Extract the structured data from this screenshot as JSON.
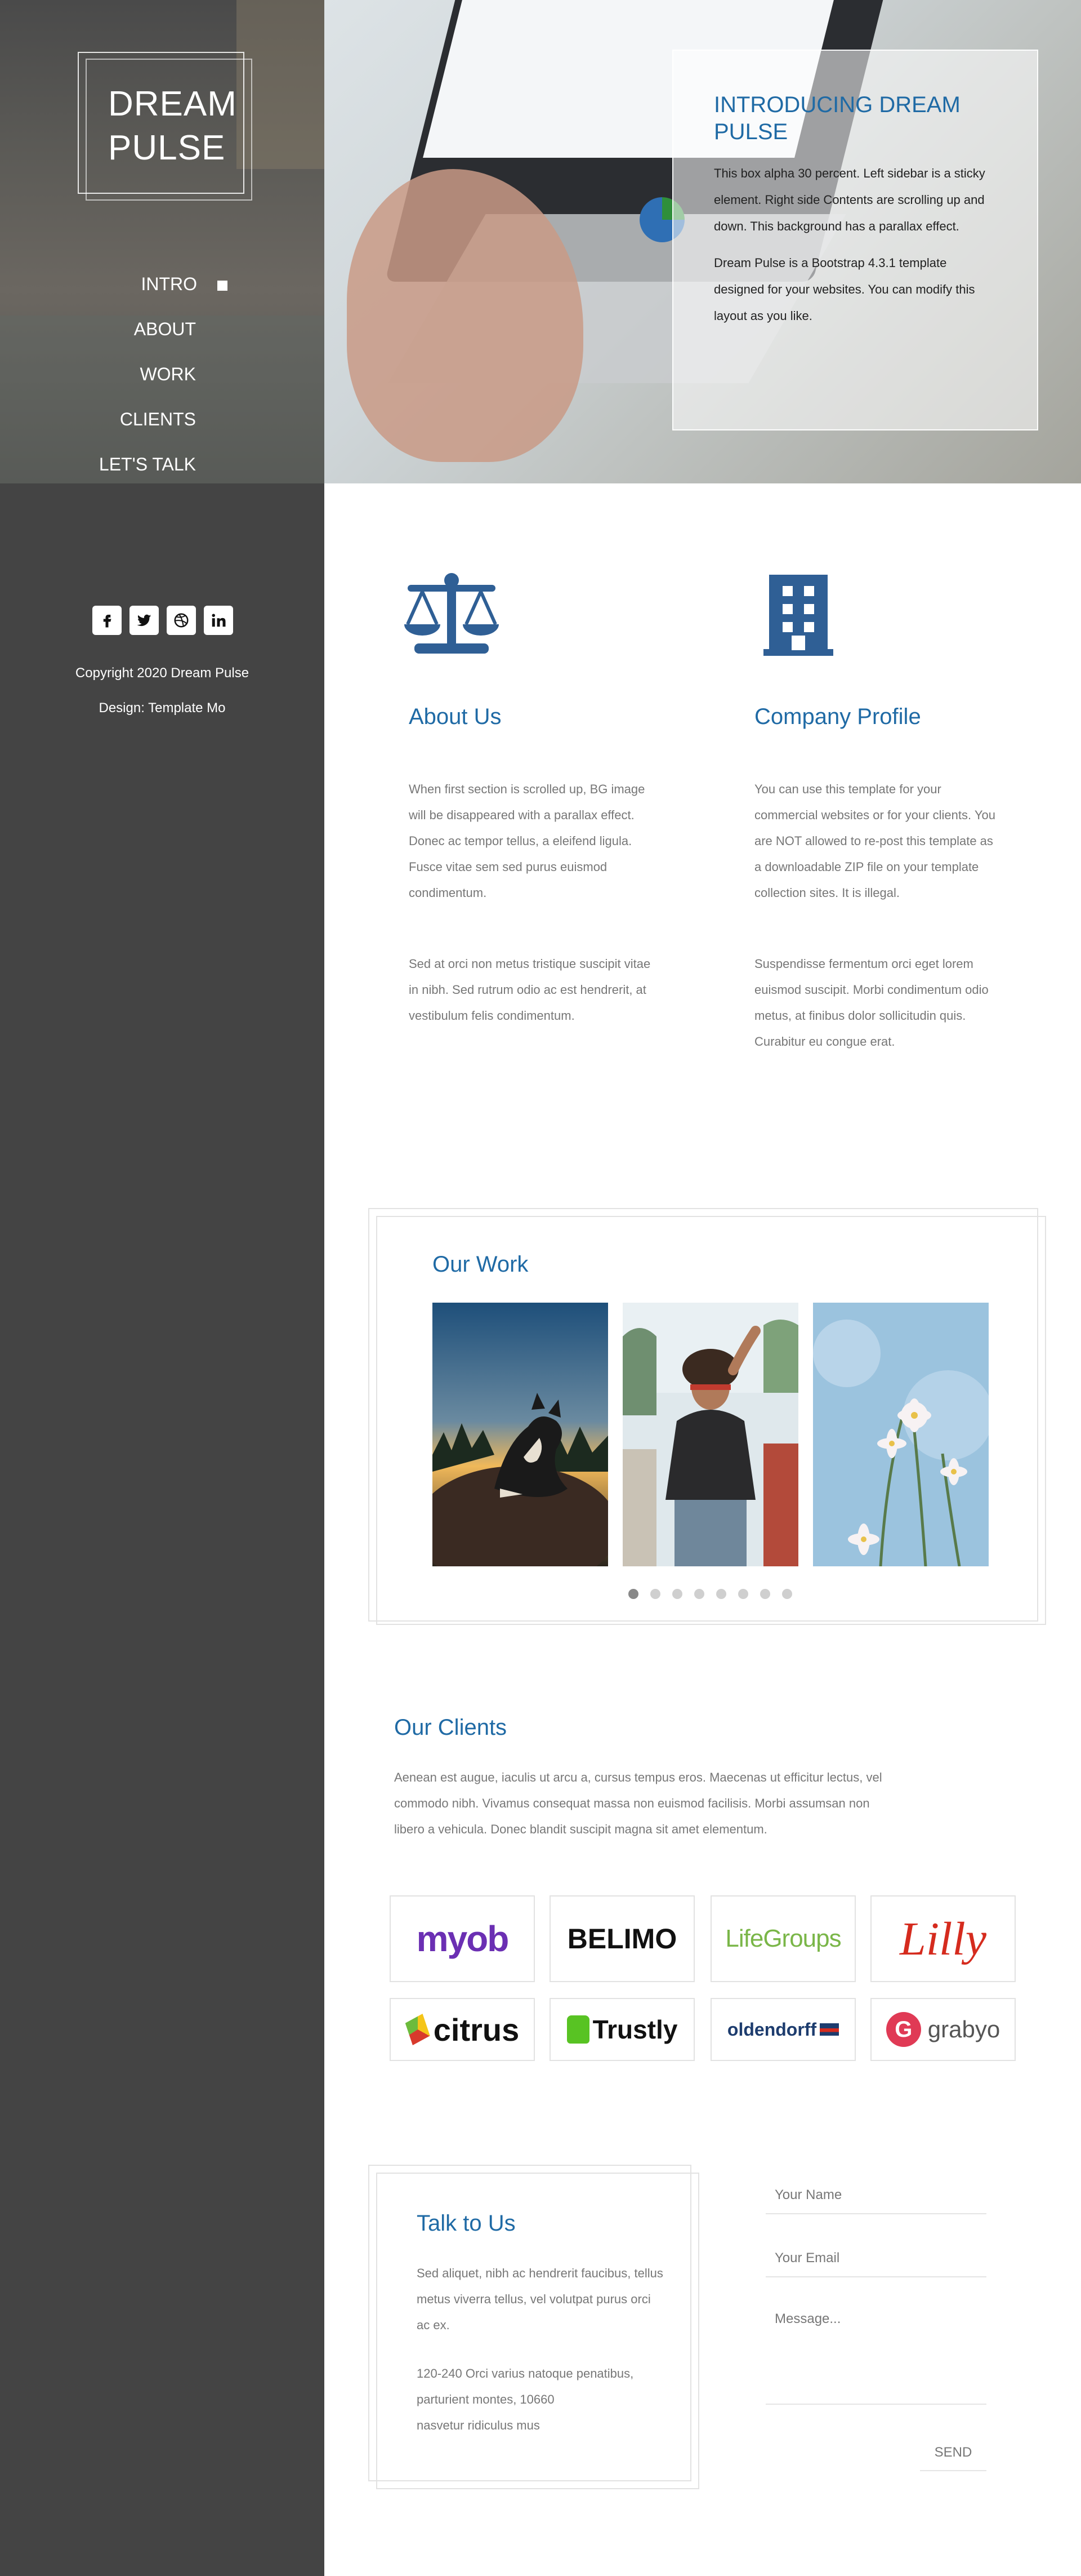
{
  "brand": {
    "line1": "DREAM",
    "line2": "PULSE"
  },
  "nav": {
    "items": [
      {
        "label": "INTRO",
        "active": true
      },
      {
        "label": "ABOUT",
        "active": false
      },
      {
        "label": "WORK",
        "active": false
      },
      {
        "label": "CLIENTS",
        "active": false
      },
      {
        "label": "LET'S TALK",
        "active": false
      }
    ]
  },
  "social": [
    {
      "icon": "facebook-icon"
    },
    {
      "icon": "twitter-icon"
    },
    {
      "icon": "dribbble-icon"
    },
    {
      "icon": "linkedin-icon"
    }
  ],
  "footer": {
    "copyright": "Copyright 2020 Dream Pulse",
    "design": "Design: Template Mo"
  },
  "hero": {
    "title": "INTRODUCING DREAM PULSE",
    "p1": "This box alpha 30 percent. Left sidebar is a sticky element. Right side Contents are scrolling up and down. This background has a parallax effect.",
    "p2": "Dream Pulse is a Bootstrap 4.3.1 template designed for your websites. You can modify this layout as you like."
  },
  "about": {
    "title": "About Us",
    "icon": "scale-icon",
    "p1": "When first section is scrolled up, BG image will be disappeared with a parallax effect. Donec ac tempor tellus, a eleifend ligula. Fusce vitae sem sed purus euismod condimentum.",
    "p2": "Sed at orci non metus tristique suscipit vitae in nibh. Sed rutrum odio ac est hendrerit, at vestibulum felis condimentum."
  },
  "company": {
    "title": "Company Profile",
    "icon": "building-icon",
    "p1": "You can use this template for your commercial websites or for your clients. You are NOT allowed to re-post this template as a downloadable ZIP file on your template collection sites. It is illegal.",
    "p2": "Suspendisse fermentum orci eget lorem euismod suscipit. Morbi condimentum odio metus, at finibus dolor sollicitudin quis. Curabitur eu congue erat."
  },
  "work": {
    "title": "Our Work",
    "images": [
      "dog-photo",
      "woman-photo",
      "flowers-photo"
    ],
    "slide_count": 8,
    "active_slide": 1
  },
  "clients": {
    "title": "Our Clients",
    "p": "Aenean est augue, iaculis ut arcu a, cursus tempus eros. Maecenas ut efficitur lectus, vel commodo nibh. Vivamus consequat massa non euismod facilisis. Morbi assumsan non libero a vehicula. Donec blandit suscipit magna sit amet elementum.",
    "logos": [
      {
        "text": "myob",
        "color": "#6b2fb3"
      },
      {
        "text": "BELIMO",
        "color": "#111111",
        "accent": "#f26522"
      },
      {
        "text": "LifeGroups",
        "color": "#7ab648"
      },
      {
        "text": "Lilly",
        "color": "#d52b1e"
      },
      {
        "text": "citrus",
        "color": "#111111"
      },
      {
        "text": "Trustly",
        "color": "#111111",
        "accent": "#58c323"
      },
      {
        "text": "oldendorff",
        "color": "#1d3c6e"
      },
      {
        "text": "grabyo",
        "color": "#555555",
        "accent": "#e03a55"
      }
    ]
  },
  "contact": {
    "title": "Talk to Us",
    "p1": "Sed aliquet, nibh ac hendrerit faucibus, tellus metus viverra tellus, vel volutpat purus orci ac ex.",
    "address1": "120-240 Orci varius natoque penatibus,",
    "address2": "parturient montes, 10660",
    "address3": "nasvetur ridiculus mus",
    "name_placeholder": "Your Name",
    "email_placeholder": "Your Email",
    "message_placeholder": "Message...",
    "send_label": "SEND"
  },
  "colors": {
    "accent": "#1f6aa5",
    "sidebar": "#444444"
  }
}
